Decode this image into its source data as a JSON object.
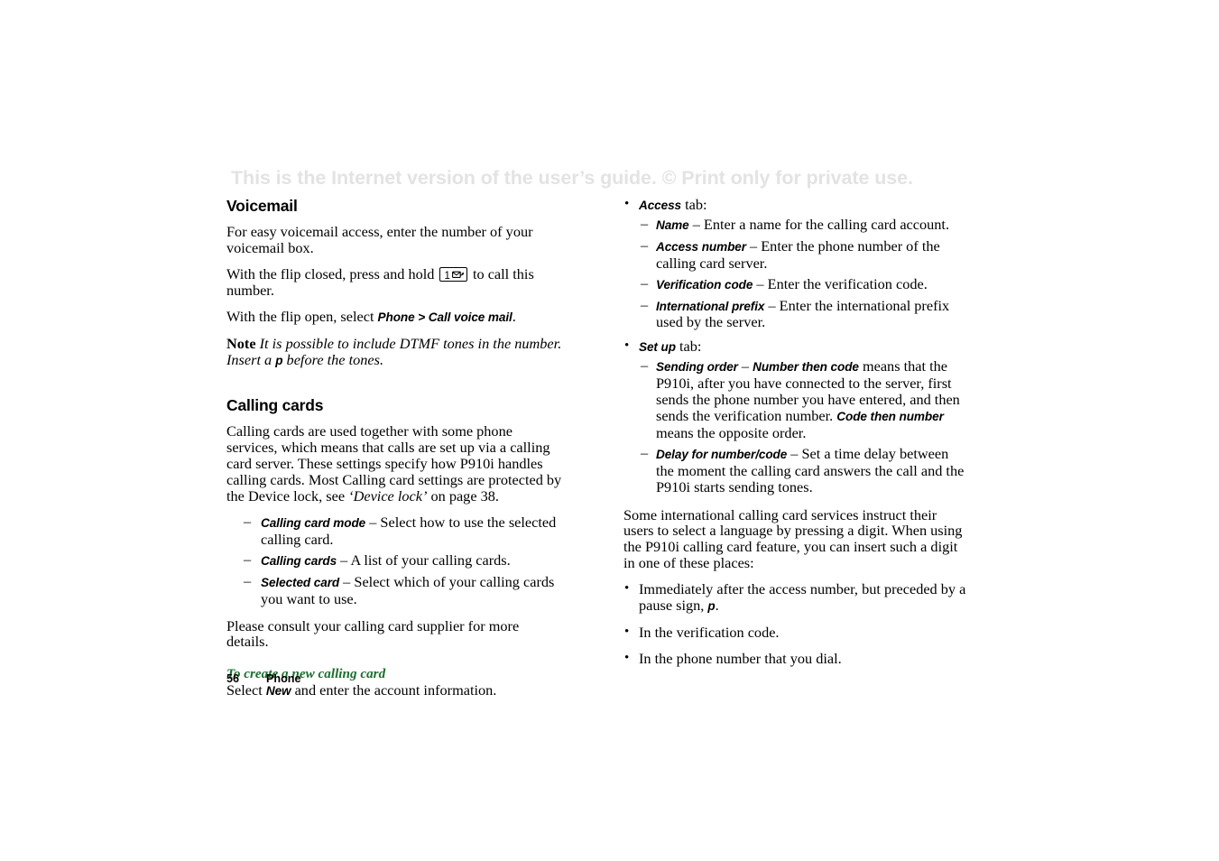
{
  "watermark": {
    "text": "This is the Internet version of the user’s guide. © Print only for private use."
  },
  "left_column": {
    "voicemail": {
      "heading": "Voicemail",
      "p1": "For easy voicemail access, enter the number of your voicemail box.",
      "p2_before": "With the flip closed, press and hold",
      "keycap_number": "1",
      "keycap_icon": "voicemail-envelope-icon",
      "p2_after": "to call this number.",
      "p3_before": "With the flip open, select ",
      "p3_ui": "Phone > Call voice mail",
      "p3_after": ".",
      "note_label": "Note",
      "note_text_a": "It is possible to include DTMF tones in the number. Insert a ",
      "note_ui": "p",
      "note_text_b": " before the tones."
    },
    "calling_cards": {
      "heading": "Calling cards",
      "p1_a": "Calling cards are used together with some phone services, which means that calls are set up via a calling card server. These settings specify how P910i handles calling cards. Most Calling card settings are protected by the Device lock, see ",
      "p1_ref": "‘Device lock’",
      "p1_b": " on page 38.",
      "items": [
        {
          "marker": "–",
          "term": "Calling card mode",
          "text": " – Select how to use the selected calling card."
        },
        {
          "marker": "–",
          "term": "Calling cards",
          "text": " – A list of your calling cards."
        },
        {
          "marker": "–",
          "term": "Selected card",
          "text": " – Select which of your calling cards you want to use."
        }
      ],
      "p2": "Please consult your calling card supplier for more details.",
      "proc_heading": "To create a new calling card",
      "proc_before": "Select ",
      "proc_ui": "New",
      "proc_after": " and enter the account information."
    }
  },
  "right_column": {
    "access_group": {
      "marker": "•",
      "term": "Access",
      "text": " tab:",
      "items": [
        {
          "marker": "–",
          "term": "Name",
          "text": " – Enter a name for the calling card account."
        },
        {
          "marker": "–",
          "term": "Access number",
          "text": " – Enter the phone number of the calling card server."
        },
        {
          "marker": "–",
          "term": "Verification code",
          "text": " – Enter the verification code."
        },
        {
          "marker": "–",
          "term": "International prefix",
          "text": " – Enter the international prefix used by the server."
        }
      ]
    },
    "setup_group": {
      "marker": "•",
      "term": "Set up",
      "text": " tab:",
      "sending_order": {
        "marker": "–",
        "term1": "Sending order",
        "sep1": " – ",
        "term2": "Number then code",
        "text1": " means that the P910i, after you have connected to the server, first sends the phone number you have entered, and then sends the verification number. ",
        "term3": "Code then number",
        "text2": " means the opposite order."
      },
      "delay": {
        "marker": "–",
        "term": "Delay for number/code",
        "text": " – Set a time delay between the moment the calling card answers the call and the P910i starts sending tones."
      }
    },
    "p1": "Some international calling card services instruct their users to select a language by pressing a digit. When using the P910i calling card feature, you can insert such a digit in one of these places:",
    "places": [
      {
        "marker": "•",
        "text_a": "Immediately after the access number, but preceded by a pause sign, ",
        "ui": "p",
        "text_b": "."
      },
      {
        "marker": "•",
        "text_a": "In the verification code.",
        "ui": "",
        "text_b": ""
      },
      {
        "marker": "•",
        "text_a": "In the phone number that you dial.",
        "ui": "",
        "text_b": ""
      }
    ]
  },
  "footer": {
    "page_number": "56",
    "section": "Phone"
  },
  "colors": {
    "watermark": "#e3e3e3",
    "procedure_heading": "#1a6e2d",
    "text": "#000000",
    "background": "#ffffff"
  }
}
